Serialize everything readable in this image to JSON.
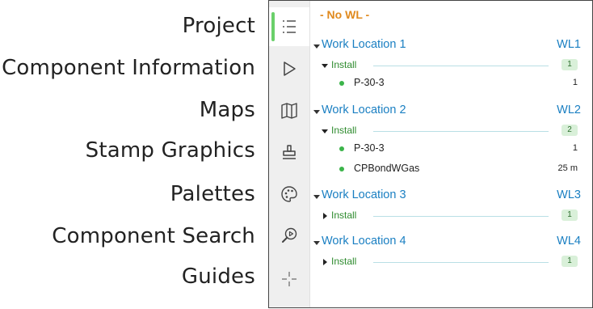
{
  "menu_labels": [
    "Project",
    "Component Information",
    "Maps",
    "Stamp Graphics",
    "Palettes",
    "Component Search",
    "Guides"
  ],
  "rail": {
    "icons": [
      "list-icon",
      "play-triangle-icon",
      "map-icon",
      "stamp-icon",
      "palette-icon",
      "search-play-icon",
      "crosshair-icon"
    ],
    "active_index": 0
  },
  "panel": {
    "no_wl": "- No WL -",
    "work_locations": [
      {
        "name": "Work Location 1",
        "code": "WL1",
        "groups": [
          {
            "name": "Install",
            "count": "1",
            "expanded": true,
            "items": [
              {
                "name": "P-30-3",
                "qty": "1"
              }
            ]
          }
        ]
      },
      {
        "name": "Work Location 2",
        "code": "WL2",
        "groups": [
          {
            "name": "Install",
            "count": "2",
            "expanded": true,
            "items": [
              {
                "name": "P-30-3",
                "qty": "1"
              },
              {
                "name": "CPBondWGas",
                "qty": "25 m"
              }
            ]
          }
        ]
      },
      {
        "name": "Work Location 3",
        "code": "WL3",
        "groups": [
          {
            "name": "Install",
            "count": "1",
            "expanded": false,
            "items": []
          }
        ]
      },
      {
        "name": "Work Location 4",
        "code": "WL4",
        "groups": [
          {
            "name": "Install",
            "count": "1",
            "expanded": false,
            "items": []
          }
        ]
      }
    ]
  },
  "colors": {
    "accent_orange": "#e08a1e",
    "link_blue": "#1a7fc2",
    "group_green": "#2e8b2e",
    "active_indicator": "#6ad06a",
    "badge_bg": "#d9f0d9",
    "dot_green": "#3bb44a"
  }
}
